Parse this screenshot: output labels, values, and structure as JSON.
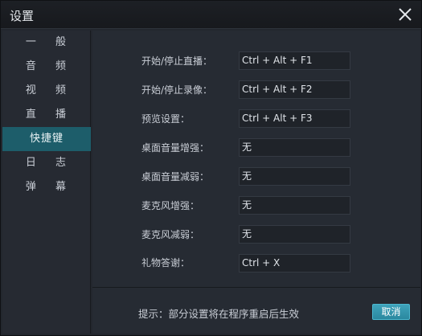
{
  "window": {
    "title": "设置"
  },
  "sidebar": {
    "items": [
      {
        "label": "一 般",
        "active": false
      },
      {
        "label": "音 频",
        "active": false
      },
      {
        "label": "视 频",
        "active": false
      },
      {
        "label": "直 播",
        "active": false
      },
      {
        "label": "快捷键",
        "active": true
      },
      {
        "label": "日 志",
        "active": false
      },
      {
        "label": "弹 幕",
        "active": false
      }
    ]
  },
  "hotkeys": [
    {
      "label": "开始/停止直播：",
      "value": "Ctrl + Alt + F1"
    },
    {
      "label": "开始/停止录像：",
      "value": "Ctrl + Alt + F2"
    },
    {
      "label": "预览设置：",
      "value": "Ctrl + Alt + F3"
    },
    {
      "label": "桌面音量增强：",
      "value": "无"
    },
    {
      "label": "桌面音量减弱：",
      "value": "无"
    },
    {
      "label": "麦克风增强：",
      "value": "无"
    },
    {
      "label": "麦克风减弱：",
      "value": "无"
    },
    {
      "label": "礼物答谢：",
      "value": "Ctrl + X"
    }
  ],
  "footer": {
    "hint": "提示：部分设置将在程序重启后生效",
    "cancel_label": "取消"
  },
  "colors": {
    "accent": "#1d5d6a",
    "button": "#2f95ad"
  },
  "icons": {
    "close": "close-icon"
  }
}
